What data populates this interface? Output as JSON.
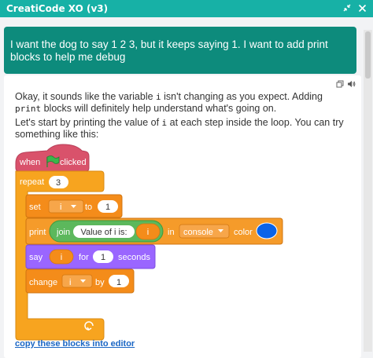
{
  "window": {
    "title": "CreatiCode XO (v3)",
    "collapse_icon": "collapse-arrows",
    "close_icon": "x"
  },
  "user_message": "I want the dog to say 1 2 3, but it keeps saying 1. I want to add print blocks to help me debug",
  "assistant": {
    "para1_before": "Okay, it sounds like the variable ",
    "para1_var": "i",
    "para1_mid": " isn't changing as you expect. Adding ",
    "para1_code": "print",
    "para1_after": " blocks will definitely help understand what's going on.",
    "para2_before": "Let's start by printing the value of ",
    "para2_var": "i",
    "para2_after": " at each step inside the loop. You can try something like this:",
    "copy_link": "copy these blocks into editor"
  },
  "blocks": {
    "when_clicked": {
      "when": "when",
      "clicked": "clicked"
    },
    "repeat": {
      "label": "repeat",
      "count": "3"
    },
    "set": {
      "label": "set",
      "var": "i",
      "to": "to",
      "value": "1"
    },
    "print": {
      "label": "print",
      "join": "join",
      "text": "Value of i is:",
      "var": "i",
      "in": "in",
      "target": "console",
      "color": "color",
      "color_value": "#0b63e8"
    },
    "say": {
      "label": "say",
      "var": "i",
      "for": "for",
      "seconds_value": "1",
      "seconds": "seconds"
    },
    "change": {
      "label": "change",
      "var": "i",
      "by": "by",
      "value": "1"
    }
  },
  "colors": {
    "teal_header": "#17b1a6",
    "user_bubble": "#0d8b7c",
    "events": "#d9526b",
    "control": "#f7a41f",
    "variables": "#f48c1a",
    "print": "#f59b2a",
    "operators": "#5cb85c",
    "looks": "#9a66ff",
    "link": "#1a66c4"
  }
}
